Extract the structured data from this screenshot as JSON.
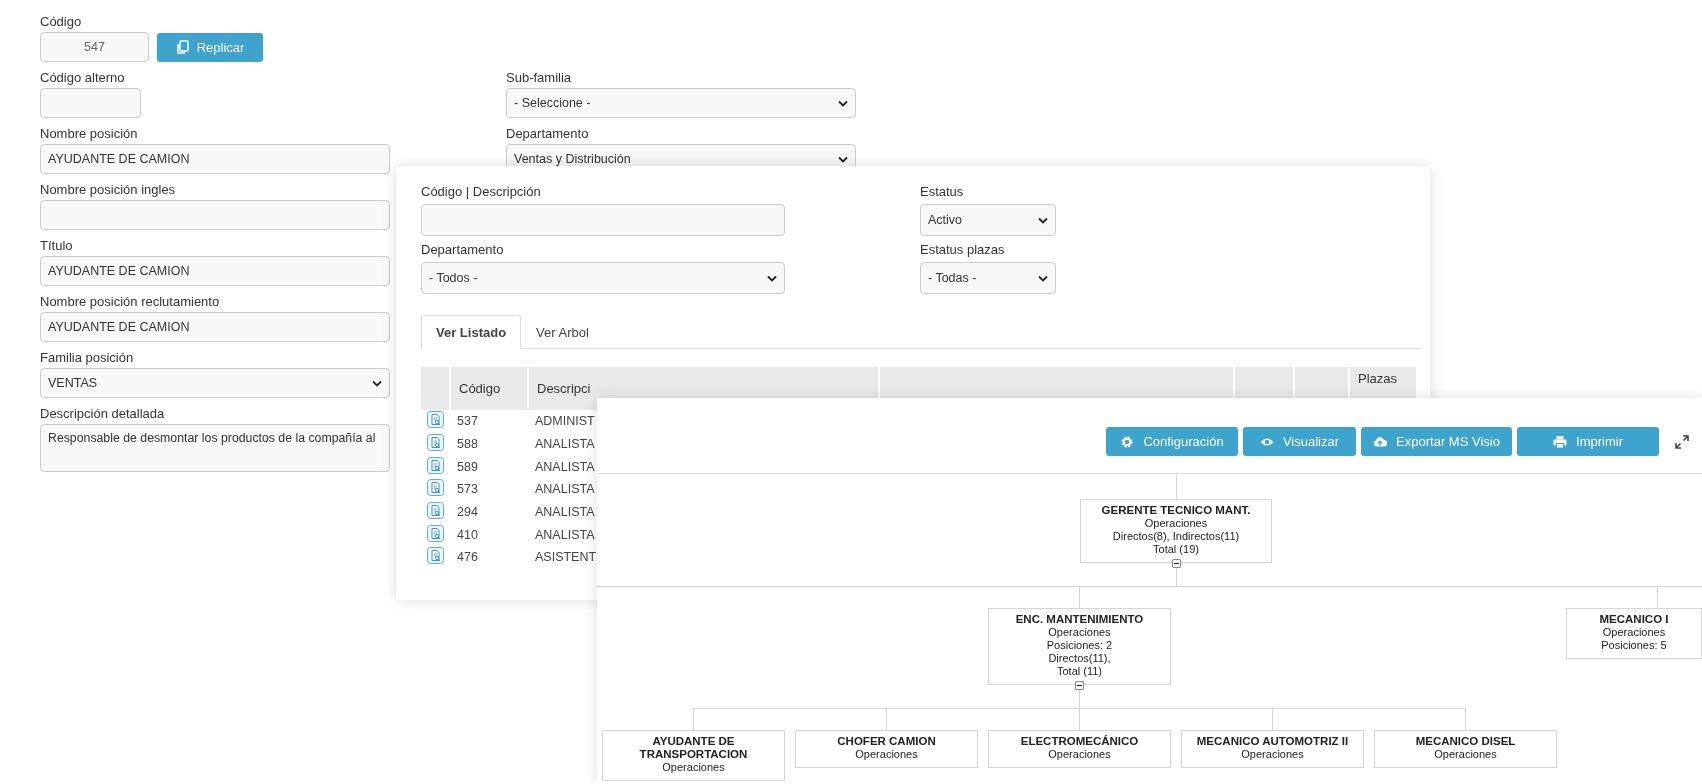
{
  "form": {
    "left": [
      {
        "kind": "code",
        "label": "Código",
        "value": "547",
        "button": "Replicar"
      },
      {
        "kind": "short",
        "label": "Código alterno"
      },
      {
        "kind": "text",
        "label": "Nombre posición",
        "value": "AYUDANTE DE CAMION"
      },
      {
        "kind": "text",
        "label": "Nombre posición ingles"
      },
      {
        "kind": "text",
        "label": "Título",
        "value": "AYUDANTE DE CAMION"
      },
      {
        "kind": "text",
        "label": "Nombre posición reclutamiento",
        "value": "AYUDANTE DE CAMION"
      },
      {
        "kind": "select",
        "label": "Familia posición",
        "value": "VENTAS"
      },
      {
        "kind": "textarea",
        "label": "Descripción detallada",
        "value": "Responsable de desmontar los productos de la compañía al"
      }
    ],
    "right": [
      {
        "kind": "select",
        "label": "Sub-familia",
        "value": "- Seleccione -"
      },
      {
        "kind": "select",
        "label": "Departamento",
        "value": "Ventas y Distribución"
      }
    ]
  },
  "search_panel": {
    "filters": [
      {
        "kind": "text",
        "label": "Código | Descripción"
      },
      {
        "kind": "small_select",
        "label": "Estatus",
        "value": "Activo"
      },
      {
        "kind": "select",
        "label": "Departamento",
        "value": "- Todos -"
      },
      {
        "kind": "small_select",
        "label": "Estatus plazas",
        "value": "- Todas -"
      }
    ],
    "tabs": [
      {
        "label": "Ver Listado",
        "selected": true
      },
      {
        "label": "Ver Arbol",
        "selected": false
      }
    ],
    "table": {
      "columns": [
        "Código",
        "Descripci",
        "Plazas"
      ],
      "rows": [
        {
          "code": "537",
          "description": "ADMINIST"
        },
        {
          "code": "588",
          "description": "ANALISTA"
        },
        {
          "code": "589",
          "description": "ANALISTA"
        },
        {
          "code": "573",
          "description": "ANALISTA"
        },
        {
          "code": "294",
          "description": "ANALISTA"
        },
        {
          "code": "410",
          "description": "ANALISTA"
        },
        {
          "code": "476",
          "description": "ASISTENT"
        }
      ]
    }
  },
  "org_panel": {
    "toolbar": [
      {
        "kind": "gear",
        "label": "Configuración"
      },
      {
        "kind": "eye",
        "label": "Visualizar"
      },
      {
        "kind": "cloud",
        "label": "Exportar MS Visio"
      },
      {
        "kind": "print",
        "label": "Imprimir"
      }
    ],
    "org_chart": {
      "root": {
        "title": "GERENTE TECNICO MANT.",
        "lines": [
          "Operaciones",
          "Directos(8), Indirectos(11)",
          "Total (19)"
        ],
        "expanded": true,
        "children": [
          {
            "title": "ENC. MANTENIMIENTO",
            "lines": [
              "Operaciones",
              "Posiciones: 2",
              "Directos(11),",
              "Total (11)"
            ],
            "expanded": true,
            "children": [
              {
                "title": "AYUDANTE DE TRANSPORTACION",
                "lines": [
                  "Operaciones"
                ]
              },
              {
                "title": "CHOFER CAMION",
                "lines": [
                  "Operaciones"
                ]
              },
              {
                "title": "ELECTROMECÁNICO",
                "lines": [
                  "Operaciones"
                ]
              },
              {
                "title": "MECANICO AUTOMOTRIZ II",
                "lines": [
                  "Operaciones"
                ]
              },
              {
                "title": "MECANICO DISEL",
                "lines": [
                  "Operaciones"
                ]
              }
            ]
          },
          {
            "title": "MECANICO I",
            "lines": [
              "Operaciones",
              "Posiciones: 5"
            ]
          }
        ]
      }
    }
  }
}
